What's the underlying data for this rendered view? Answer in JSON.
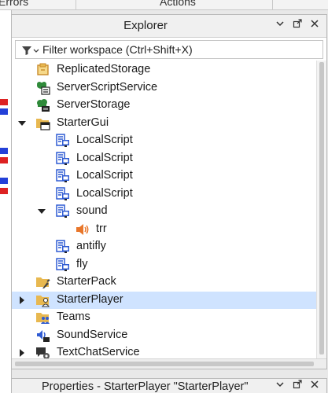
{
  "top_tabs": [
    "Errors",
    "Actions"
  ],
  "explorer": {
    "title": "Explorer",
    "filter_placeholder": "Filter workspace (Ctrl+Shift+X)",
    "items": [
      {
        "label": "ReplicatedStorage",
        "icon": "replicated-storage-icon",
        "depth": 0,
        "toggle": "none",
        "selected": false
      },
      {
        "label": "ServerScriptService",
        "icon": "server-script-service-icon",
        "depth": 0,
        "toggle": "none",
        "selected": false
      },
      {
        "label": "ServerStorage",
        "icon": "server-storage-icon",
        "depth": 0,
        "toggle": "none",
        "selected": false
      },
      {
        "label": "StarterGui",
        "icon": "starter-gui-icon",
        "depth": 0,
        "toggle": "expanded",
        "selected": false
      },
      {
        "label": "LocalScript",
        "icon": "local-script-icon",
        "depth": 1,
        "toggle": "none",
        "selected": false
      },
      {
        "label": "LocalScript",
        "icon": "local-script-icon",
        "depth": 1,
        "toggle": "none",
        "selected": false
      },
      {
        "label": "LocalScript",
        "icon": "local-script-icon",
        "depth": 1,
        "toggle": "none",
        "selected": false
      },
      {
        "label": "LocalScript",
        "icon": "local-script-icon",
        "depth": 1,
        "toggle": "none",
        "selected": false
      },
      {
        "label": "sound",
        "icon": "local-script-icon",
        "depth": 1,
        "toggle": "expanded",
        "selected": false
      },
      {
        "label": "trr",
        "icon": "sound-icon",
        "depth": 2,
        "toggle": "none",
        "selected": false
      },
      {
        "label": "antifly",
        "icon": "local-script-icon",
        "depth": 1,
        "toggle": "none",
        "selected": false
      },
      {
        "label": "fly",
        "icon": "local-script-icon",
        "depth": 1,
        "toggle": "none",
        "selected": false
      },
      {
        "label": "StarterPack",
        "icon": "starter-pack-icon",
        "depth": 0,
        "toggle": "none",
        "selected": false
      },
      {
        "label": "StarterPlayer",
        "icon": "starter-player-icon",
        "depth": 0,
        "toggle": "collapsed",
        "selected": true
      },
      {
        "label": "Teams",
        "icon": "teams-icon",
        "depth": 0,
        "toggle": "none",
        "selected": false
      },
      {
        "label": "SoundService",
        "icon": "sound-service-icon",
        "depth": 0,
        "toggle": "none",
        "selected": false
      },
      {
        "label": "TextChatService",
        "icon": "text-chat-service-icon",
        "depth": 0,
        "toggle": "collapsed",
        "selected": false
      }
    ]
  },
  "properties": {
    "title": "Properties - StarterPlayer \"StarterPlayer\""
  },
  "colors": {
    "selection": "#cfe3ff",
    "script_blue": "#2f5bd3",
    "folder_yellow": "#e8b850",
    "service_green": "#2f8a3a"
  }
}
